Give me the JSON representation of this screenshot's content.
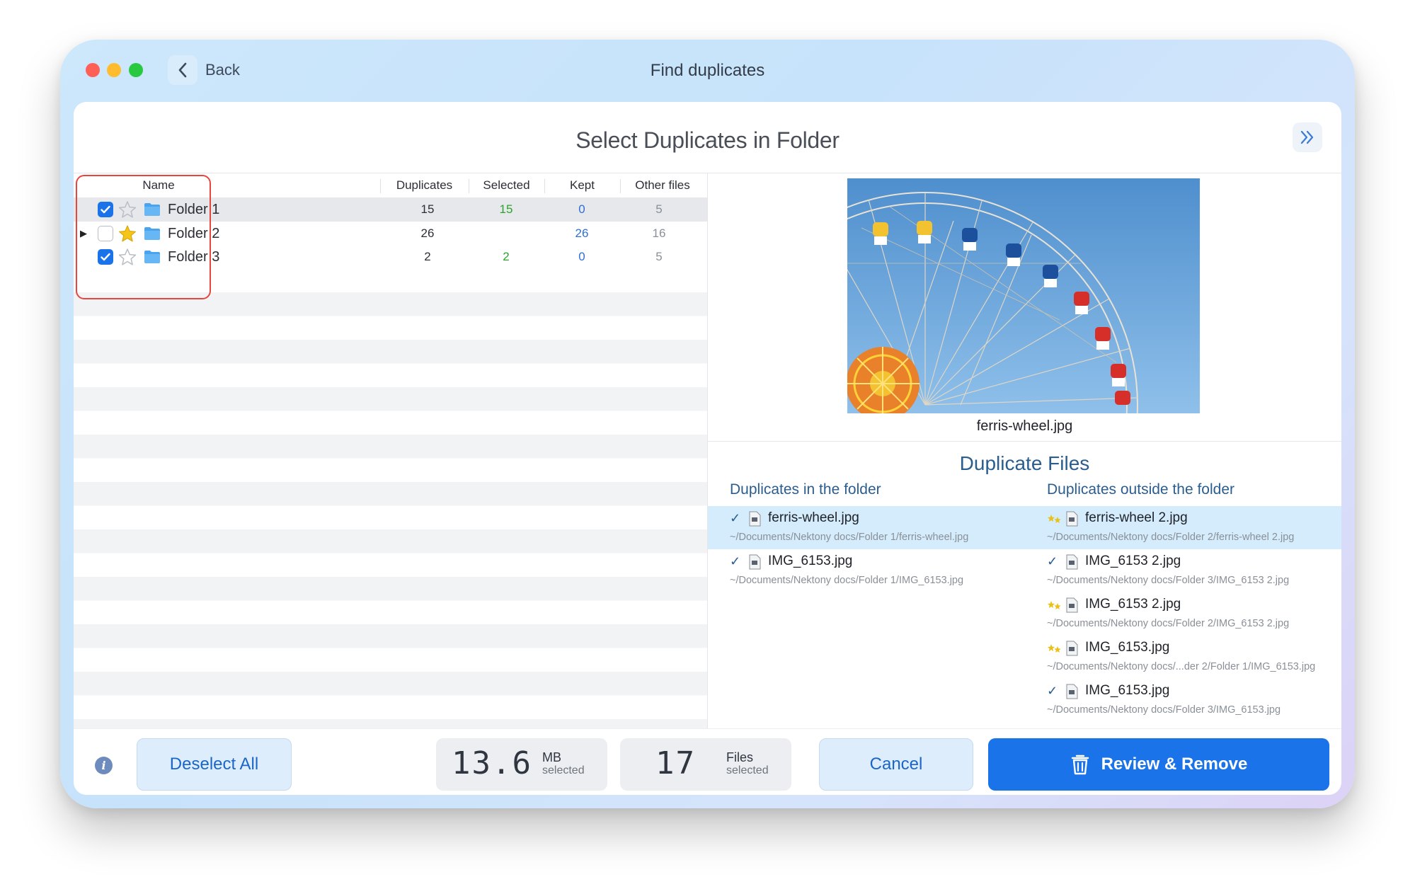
{
  "window": {
    "title": "Find duplicates",
    "back_label": "Back"
  },
  "panel": {
    "title": "Select Duplicates in Folder"
  },
  "table": {
    "columns": [
      "Name",
      "Duplicates",
      "Selected",
      "Kept",
      "Other files"
    ],
    "rows": [
      {
        "name": "Folder 1",
        "checked": true,
        "starred": false,
        "expandable": false,
        "duplicates": "15",
        "selected": "15",
        "kept": "0",
        "other": "5"
      },
      {
        "name": "Folder 2",
        "checked": false,
        "starred": true,
        "expandable": true,
        "duplicates": "26",
        "selected": "",
        "kept": "26",
        "other": "16"
      },
      {
        "name": "Folder 3",
        "checked": true,
        "starred": false,
        "expandable": false,
        "duplicates": "2",
        "selected": "2",
        "kept": "0",
        "other": "5"
      }
    ]
  },
  "preview": {
    "filename": "ferris-wheel.jpg"
  },
  "duplicate_files": {
    "title": "Duplicate Files",
    "in_folder_label": "Duplicates in the folder",
    "outside_folder_label": "Duplicates outside the folder",
    "in_folder": [
      {
        "name": "ferris-wheel.jpg",
        "path": "~/Documents/Nektony docs/Folder 1/ferris-wheel.jpg",
        "mark": "check"
      },
      {
        "name": "IMG_6153.jpg",
        "path": "~/Documents/Nektony docs/Folder 1/IMG_6153.jpg",
        "mark": "check"
      }
    ],
    "outside_folder": [
      {
        "name": "ferris-wheel 2.jpg",
        "path": "~/Documents/Nektony docs/Folder 2/ferris-wheel 2.jpg",
        "mark": "stars"
      },
      {
        "name": "IMG_6153 2.jpg",
        "path": "~/Documents/Nektony docs/Folder 3/IMG_6153 2.jpg",
        "mark": "check"
      },
      {
        "name": "IMG_6153 2.jpg",
        "path": "~/Documents/Nektony docs/Folder 2/IMG_6153 2.jpg",
        "mark": "stars"
      },
      {
        "name": "IMG_6153.jpg",
        "path": "~/Documents/Nektony docs/...der 2/Folder 1/IMG_6153.jpg",
        "mark": "stars"
      },
      {
        "name": "IMG_6153.jpg",
        "path": "~/Documents/Nektony docs/Folder 3/IMG_6153.jpg",
        "mark": "check"
      }
    ]
  },
  "footer": {
    "deselect_label": "Deselect All",
    "size_value": "13.6",
    "size_unit": "MB",
    "size_sub": "selected",
    "files_value": "17",
    "files_unit": "Files",
    "files_sub": "selected",
    "cancel_label": "Cancel",
    "review_label": "Review & Remove"
  },
  "colors": {
    "accent": "#1a73e8",
    "selected_count": "#2aa52a",
    "kept_count": "#2f6fd6",
    "highlight_row": "#d4ecfb"
  },
  "icons": [
    "chevron-left-icon",
    "double-chevron-right-icon",
    "star-icon",
    "folder-icon",
    "file-icon",
    "check-icon",
    "info-icon",
    "trash-icon"
  ]
}
